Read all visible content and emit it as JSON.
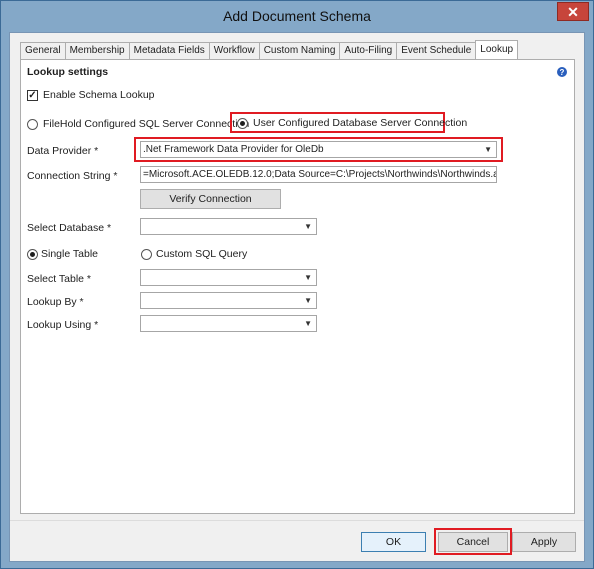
{
  "window": {
    "title": "Add Document Schema",
    "close_glyph": "✕"
  },
  "tabs": [
    {
      "label": "General"
    },
    {
      "label": "Membership"
    },
    {
      "label": "Metadata Fields"
    },
    {
      "label": "Workflow"
    },
    {
      "label": "Custom Naming"
    },
    {
      "label": "Auto-Filing"
    },
    {
      "label": "Event Schedule"
    },
    {
      "label": "Lookup",
      "active": true
    }
  ],
  "lookup": {
    "section_title": "Lookup settings",
    "help_glyph": "?",
    "enable_label": "Enable Schema Lookup",
    "enable_checked": true,
    "check_glyph": "✓",
    "connection_options": {
      "filehold": "FileHold Configured SQL Server Connection",
      "user_configured": "User Configured Database Server Connection",
      "selected": "user_configured"
    },
    "data_provider_label": "Data Provider *",
    "data_provider_value": ".Net Framework Data Provider for OleDb",
    "connection_string_label": "Connection String *",
    "connection_string_value": "=Microsoft.ACE.OLEDB.12.0;Data Source=C:\\Projects\\Northwinds\\Northwinds.accdb;",
    "verify_label": "Verify Connection",
    "select_database_label": "Select Database *",
    "select_database_value": "",
    "query_options": {
      "single_table": "Single Table",
      "custom_sql": "Custom SQL Query",
      "selected": "single_table"
    },
    "select_table_label": "Select Table *",
    "select_table_value": "",
    "lookup_by_label": "Lookup By *",
    "lookup_by_value": "",
    "lookup_using_label": "Lookup Using *",
    "lookup_using_value": ""
  },
  "buttons": {
    "ok": "OK",
    "cancel": "Cancel",
    "apply": "Apply"
  },
  "colors": {
    "highlight": "#e01b22",
    "titlebar": "#84a8c8",
    "close_button": "#c7453b"
  }
}
